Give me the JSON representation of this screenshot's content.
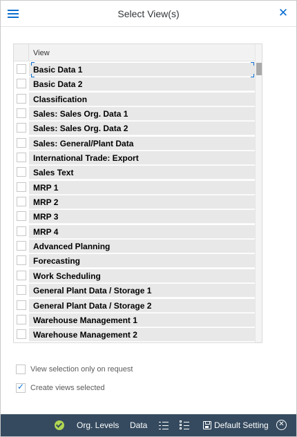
{
  "dialog": {
    "title": "Select View(s)",
    "close_glyph": "✕"
  },
  "table": {
    "column_header": "View",
    "rows": [
      {
        "label": "Basic Data 1",
        "checked": false
      },
      {
        "label": "Basic Data 2",
        "checked": false
      },
      {
        "label": "Classification",
        "checked": false
      },
      {
        "label": "Sales: Sales Org. Data 1",
        "checked": false
      },
      {
        "label": "Sales: Sales Org. Data 2",
        "checked": false
      },
      {
        "label": "Sales: General/Plant Data",
        "checked": false
      },
      {
        "label": "International Trade: Export",
        "checked": false
      },
      {
        "label": "Sales Text",
        "checked": false
      },
      {
        "label": "MRP 1",
        "checked": false
      },
      {
        "label": "MRP 2",
        "checked": false
      },
      {
        "label": "MRP 3",
        "checked": false
      },
      {
        "label": "MRP 4",
        "checked": false
      },
      {
        "label": "Advanced Planning",
        "checked": false
      },
      {
        "label": "Forecasting",
        "checked": false
      },
      {
        "label": "Work Scheduling",
        "checked": false
      },
      {
        "label": "General Plant Data / Storage 1",
        "checked": false
      },
      {
        "label": "General Plant Data / Storage 2",
        "checked": false
      },
      {
        "label": "Warehouse Management 1",
        "checked": false
      },
      {
        "label": "Warehouse Management 2",
        "checked": false
      }
    ]
  },
  "options": {
    "view_selection_on_request": {
      "label": "View selection only on request",
      "checked": false
    },
    "create_views_selected": {
      "label": "Create views selected",
      "checked": true,
      "check_glyph": "✓"
    }
  },
  "footer": {
    "org_levels_label": "Org. Levels",
    "data_label": "Data",
    "default_setting_label": "Default Setting",
    "cancel_glyph": "✕"
  },
  "colors": {
    "accent": "#0a6ed1",
    "footer_bg": "#354a5f",
    "ok_icon": "#b0d552",
    "row_bg": "#e8e8e8"
  },
  "icons": {
    "menu": "hamburger-icon",
    "close": "close-icon",
    "ok": "ok-check-icon",
    "select_all": "select-all-icon",
    "deselect_all": "deselect-all-icon",
    "save": "save-icon",
    "cancel": "cancel-icon"
  }
}
